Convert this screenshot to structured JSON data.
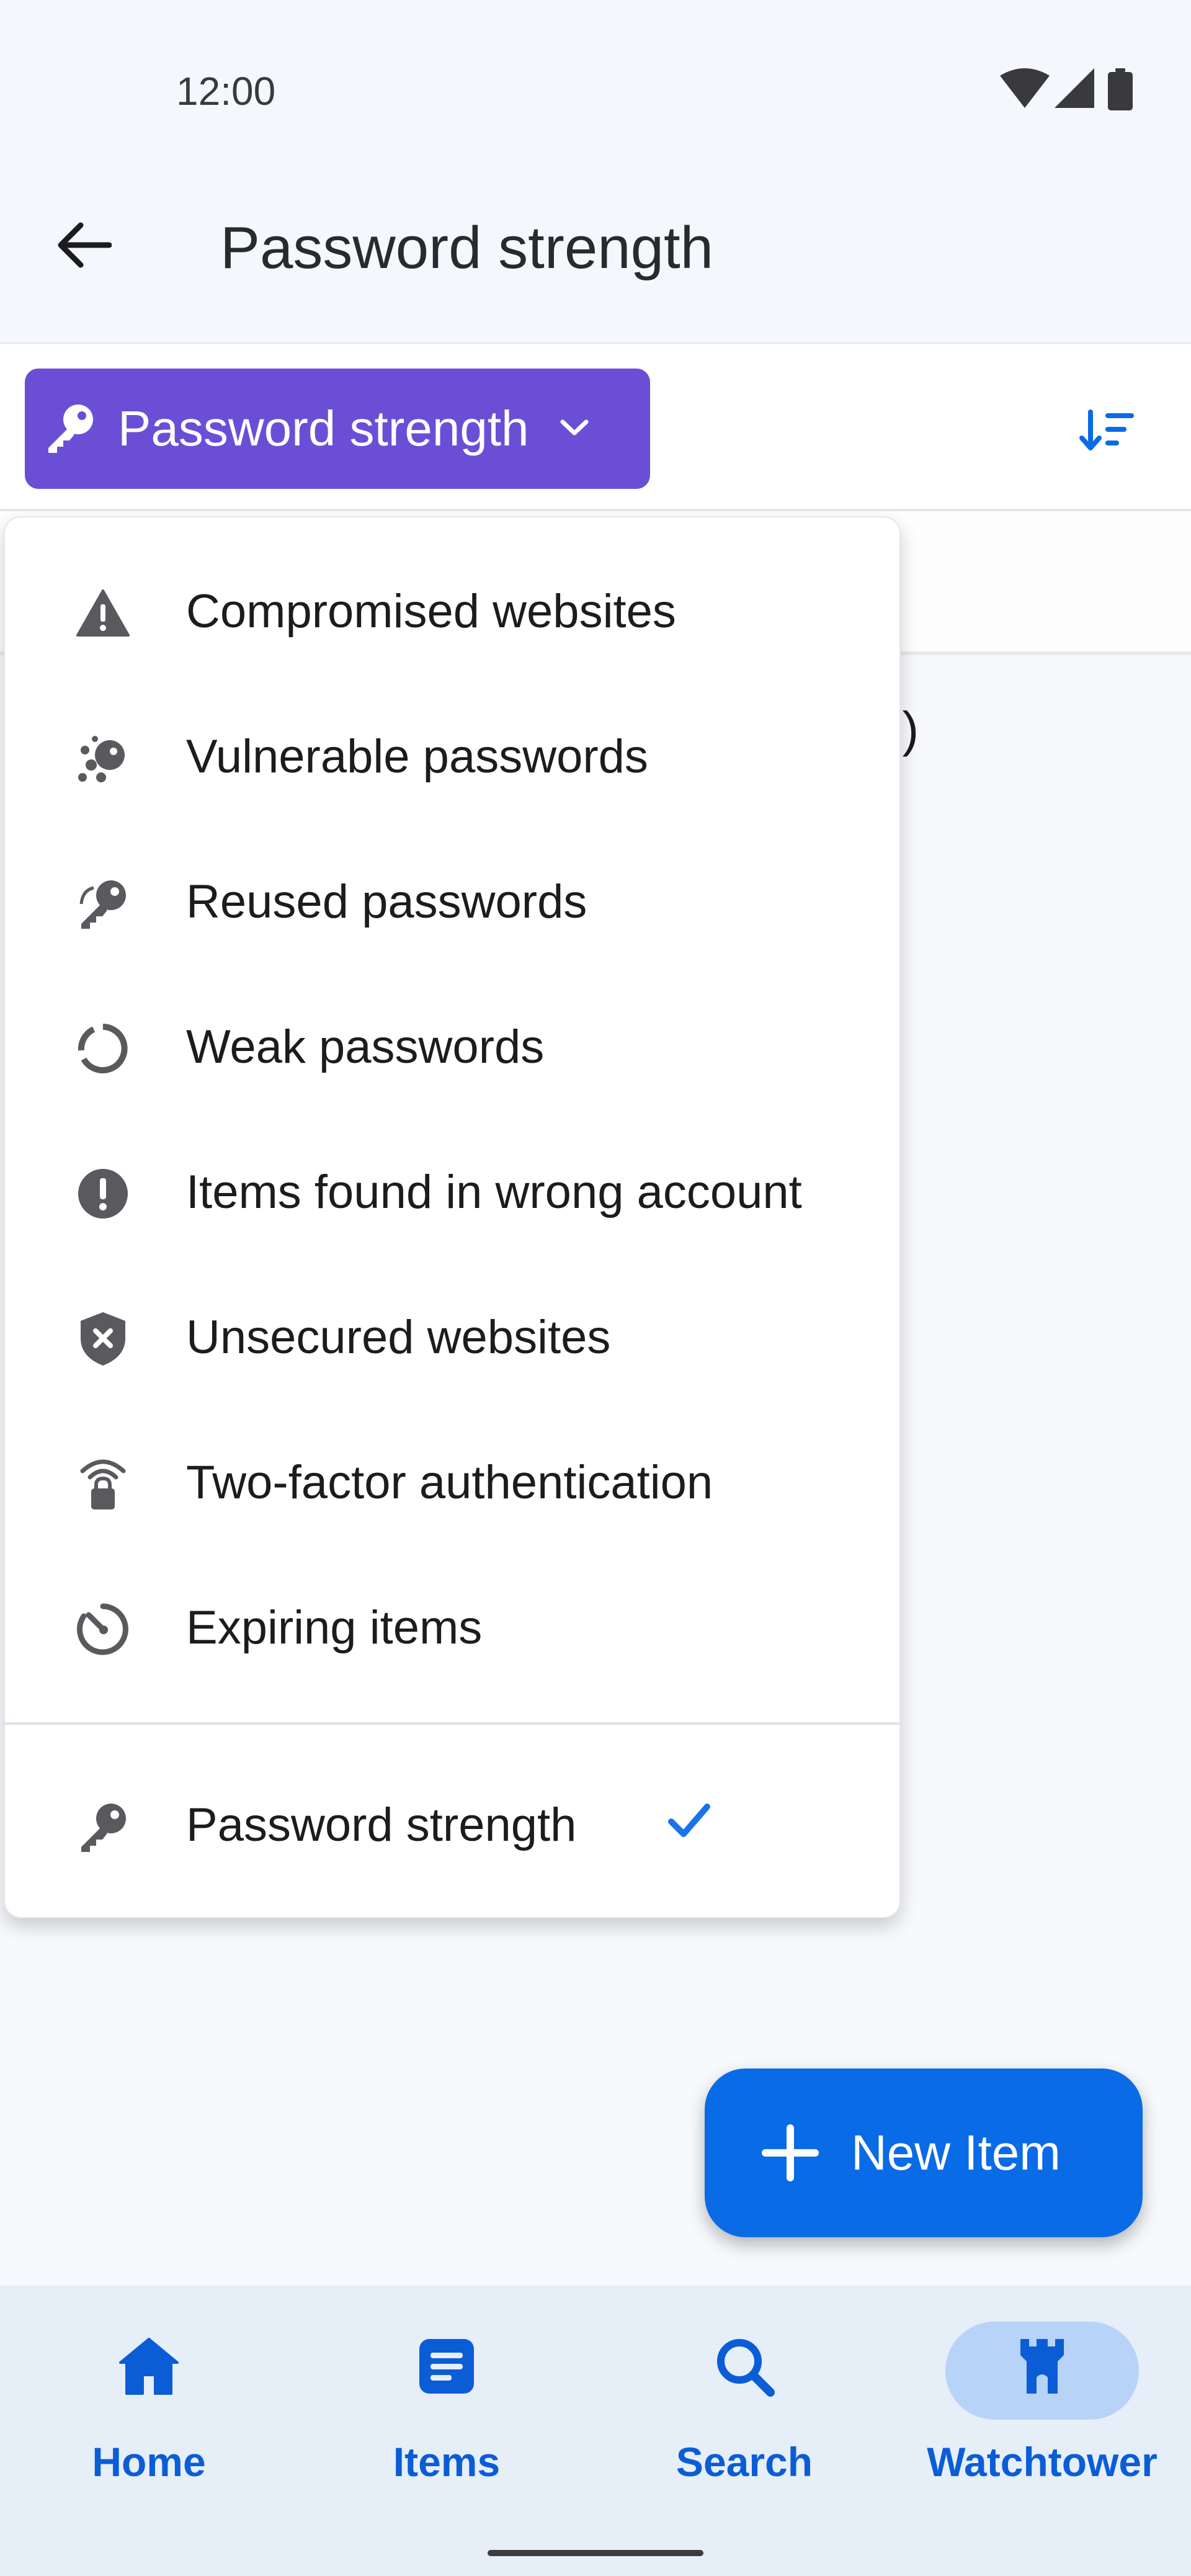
{
  "status_bar": {
    "time": "12:00"
  },
  "app_bar": {
    "title": "Password strength"
  },
  "filter": {
    "selected_label": "Password strength"
  },
  "background": {
    "partial_text": "n)"
  },
  "menu": {
    "items": [
      {
        "label": "Compromised websites",
        "icon": "warning-triangle-icon"
      },
      {
        "label": "Vulnerable passwords",
        "icon": "vulnerable-password-icon"
      },
      {
        "label": "Reused passwords",
        "icon": "reused-key-icon"
      },
      {
        "label": "Weak passwords",
        "icon": "weak-circle-icon"
      },
      {
        "label": "Items found in wrong account",
        "icon": "exclamation-circle-icon"
      },
      {
        "label": "Unsecured websites",
        "icon": "shield-x-icon"
      },
      {
        "label": "Two-factor authentication",
        "icon": "two-factor-lock-icon"
      },
      {
        "label": "Expiring items",
        "icon": "timer-icon"
      }
    ],
    "selected_item": {
      "label": "Password strength",
      "icon": "key-icon",
      "checked": true
    }
  },
  "fab": {
    "label": "New Item"
  },
  "bottom_nav": {
    "items": [
      {
        "label": "Home",
        "icon": "home-icon",
        "active": false
      },
      {
        "label": "Items",
        "icon": "items-icon",
        "active": false
      },
      {
        "label": "Search",
        "icon": "search-icon",
        "active": false
      },
      {
        "label": "Watchtower",
        "icon": "watchtower-icon",
        "active": true
      }
    ]
  },
  "colors": {
    "accent": "#0a6be6",
    "chip": "#6a4fd6",
    "nav_active_pill": "#b7d3f7",
    "nav_text": "#0b5dd6"
  }
}
